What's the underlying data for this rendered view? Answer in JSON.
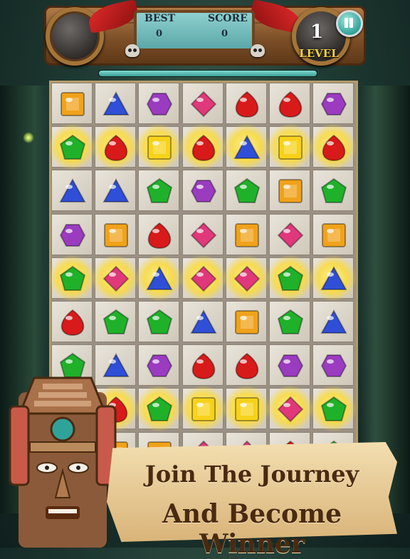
{
  "hud": {
    "best_label": "BEST",
    "best_value": "0",
    "score_label": "SCORE",
    "score_value": "0",
    "level_value": "1",
    "level_label": "LEVEL",
    "pause_icon": "pause-icon",
    "progress_fraction": 1.0
  },
  "board": {
    "columns": 7,
    "rows": 9,
    "visible_rows": 9,
    "gems": [
      [
        "orange",
        "blue",
        "purple",
        "pink",
        "red",
        "red",
        "purple"
      ],
      [
        "green",
        "red",
        "yellow",
        "red",
        "blue",
        "yellow",
        "red"
      ],
      [
        "blue",
        "blue",
        "green",
        "purple",
        "green",
        "orange",
        "green"
      ],
      [
        "purple",
        "orange",
        "red",
        "pink",
        "orange",
        "pink",
        "orange"
      ],
      [
        "green",
        "pink",
        "blue",
        "pink",
        "pink",
        "green",
        "blue"
      ],
      [
        "red",
        "green",
        "green",
        "blue",
        "orange",
        "green",
        "blue"
      ],
      [
        "green",
        "blue",
        "purple",
        "red",
        "red",
        "purple",
        "purple"
      ],
      [
        "green",
        "red",
        "green",
        "yellow",
        "yellow",
        "pink",
        "green"
      ],
      [
        "orange",
        "orange",
        "orange",
        "pink",
        "pink",
        "red",
        "green"
      ]
    ],
    "glow_rows": [
      1,
      4,
      7
    ],
    "gem_colors": {
      "red": "#d81a1a",
      "blue": "#2f4fd8",
      "green": "#1fb12a",
      "purple": "#9a3bc0",
      "pink": "#e0387a",
      "orange": "#f0a21a",
      "yellow": "#f7d21a"
    }
  },
  "banner": {
    "line1": "Join The Journey",
    "line2": "And Become  Winner"
  },
  "icons": {
    "orb": "crystal-orb-icon",
    "skull": "skull-icon",
    "feather": "feather-icon",
    "totem": "mayan-totem-icon"
  }
}
